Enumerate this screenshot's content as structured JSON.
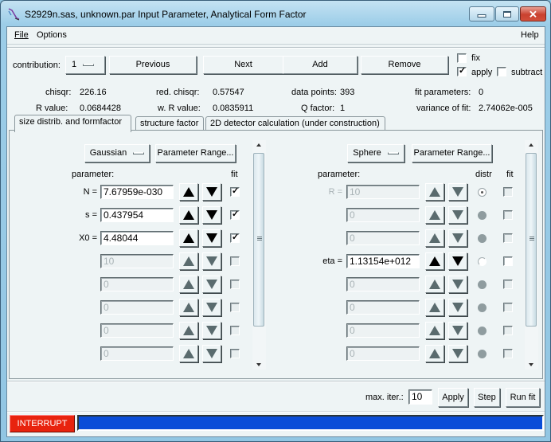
{
  "window": {
    "title": "S2929n.sas, unknown.par Input Parameter, Analytical Form Factor",
    "icon": "app-icon",
    "buttons": {
      "minimize": "minimize-icon",
      "maximize": "maximize-icon",
      "close": "close-icon"
    }
  },
  "menu": {
    "file": "File",
    "options": "Options",
    "help": "Help"
  },
  "toolbar": {
    "contribution_label": "contribution:",
    "contribution_value": "1",
    "previous": "Previous",
    "next": "Next",
    "add": "Add",
    "remove": "Remove",
    "fix": {
      "label": "fix",
      "checked": false
    },
    "apply": {
      "label": "apply",
      "checked": true
    },
    "subtract": {
      "label": "subtract",
      "checked": false
    }
  },
  "stats": {
    "chisqr": {
      "label": "chisqr:",
      "value": "226.16"
    },
    "red_chisqr": {
      "label": "red. chisqr:",
      "value": "0.57547"
    },
    "data_points": {
      "label": "data points:",
      "value": "393"
    },
    "fit_parameters": {
      "label": "fit parameters:",
      "value": "0"
    },
    "r_value": {
      "label": "R value:",
      "value": "0.0684428"
    },
    "w_r_value": {
      "label": "w. R value:",
      "value": "0.0835911"
    },
    "q_factor": {
      "label": "Q factor:",
      "value": "1"
    },
    "variance": {
      "label": "variance of fit:",
      "value": "2.74062e-005"
    }
  },
  "tabs": [
    {
      "label": "size distrib. and formfactor",
      "active": true
    },
    {
      "label": "structure factor",
      "active": false
    },
    {
      "label": "2D detector calculation (under construction)",
      "active": false
    }
  ],
  "left": {
    "distribution": "Gaussian",
    "param_range": "Parameter Range...",
    "parameter_header": "parameter:",
    "fit_header": "fit",
    "rows": [
      {
        "name": "N =",
        "value": "7.67959e-030",
        "enabled": true,
        "fit": true
      },
      {
        "name": "s =",
        "value": "0.437954",
        "enabled": true,
        "fit": true
      },
      {
        "name": "X0 =",
        "value": "4.48044",
        "enabled": true,
        "fit": true
      },
      {
        "name": "",
        "value": "10",
        "enabled": false,
        "fit": false
      },
      {
        "name": "",
        "value": "0",
        "enabled": false,
        "fit": false
      },
      {
        "name": "",
        "value": "0",
        "enabled": false,
        "fit": false
      },
      {
        "name": "",
        "value": "0",
        "enabled": false,
        "fit": false
      },
      {
        "name": "",
        "value": "0",
        "enabled": false,
        "fit": false
      }
    ]
  },
  "right": {
    "formfactor": "Sphere",
    "param_range": "Parameter Range...",
    "parameter_header": "parameter:",
    "distr_header": "distr",
    "fit_header": "fit",
    "rows": [
      {
        "name": "R =",
        "value": "10",
        "enabled": false,
        "distr": "selected",
        "fit": false
      },
      {
        "name": "",
        "value": "0",
        "enabled": false,
        "distr": "disabled",
        "fit": false
      },
      {
        "name": "",
        "value": "0",
        "enabled": false,
        "distr": "disabled",
        "fit": false
      },
      {
        "name": "eta =",
        "value": "1.13154e+012",
        "enabled": true,
        "distr": "empty",
        "fit": false
      },
      {
        "name": "",
        "value": "0",
        "enabled": false,
        "distr": "disabled",
        "fit": false
      },
      {
        "name": "",
        "value": "0",
        "enabled": false,
        "distr": "disabled",
        "fit": false
      },
      {
        "name": "",
        "value": "0",
        "enabled": false,
        "distr": "disabled",
        "fit": false
      },
      {
        "name": "",
        "value": "0",
        "enabled": false,
        "distr": "disabled",
        "fit": false
      }
    ]
  },
  "footer": {
    "max_iter_label": "max. iter.:",
    "max_iter_value": "10",
    "apply": "Apply",
    "step": "Step",
    "run_fit": "Run fit",
    "interrupt": "INTERRUPT",
    "progress_fraction": 1.0,
    "interrupt_color": "#e8230e",
    "progress_color": "#0a4dd8"
  }
}
